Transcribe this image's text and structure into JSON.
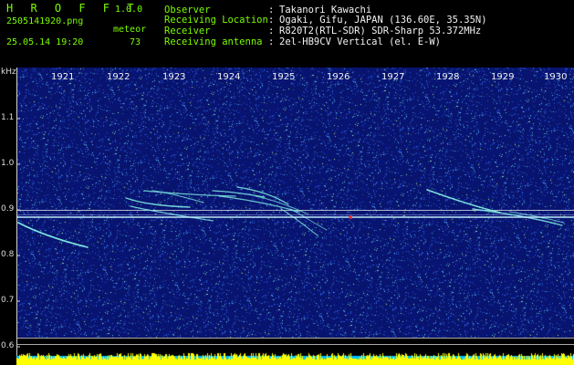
{
  "app": {
    "name": "H R O F F T",
    "version": "1.0.0"
  },
  "file": {
    "name": "2505141920.png",
    "timestamp": "25.05.14 19:20",
    "meteor_label": "meteor",
    "meteor_count": "73"
  },
  "info": [
    {
      "label": "Observer",
      "value": "Takanori Kawachi"
    },
    {
      "label": "Receiving Location",
      "value": "Ogaki, Gifu, JAPAN (136.60E, 35.35N)"
    },
    {
      "label": "Receiver",
      "value": "R820T2(RTL-SDR) SDR-Sharp 53.372MHz"
    },
    {
      "label": "Receiving antenna",
      "value": "2el-HB9CV Vertical (el. E-W)"
    }
  ],
  "info_separator": ":",
  "axis": {
    "y_unit": "kHz",
    "y_ticks": [
      "1.1",
      "1.0",
      "0.9",
      "0.8",
      "0.7",
      "0.6"
    ],
    "x_ticks": [
      "1921",
      "1922",
      "1923",
      "1924",
      "1925",
      "1926",
      "1927",
      "1928",
      "1929",
      "1930"
    ]
  },
  "colors": {
    "background": "#000000",
    "waterfall": "#0a1a6e",
    "header_lime": "#7CFC00",
    "carrier": "#ffffff",
    "meteor_trail": "#7ee8e0",
    "level_bar_low": "#00bfff",
    "level_bar_high": "#ffff00"
  }
}
